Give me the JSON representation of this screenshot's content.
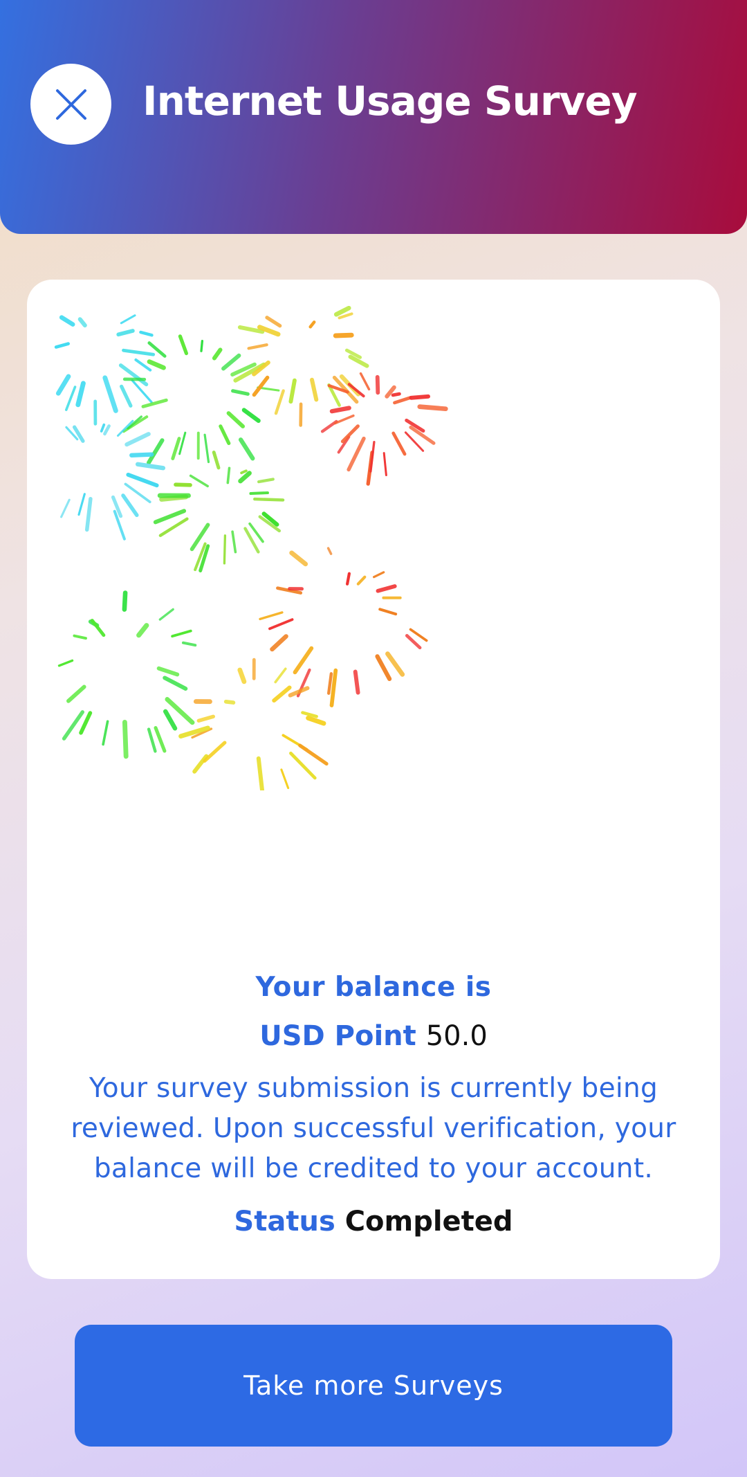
{
  "header": {
    "title": "Internet Usage Survey",
    "close_icon": "close-icon"
  },
  "card": {
    "animation": "fireworks",
    "balance_label": "Your balance is",
    "currency_label": "USD Point",
    "balance_value": "50.0",
    "message": "Your survey submission is currently being reviewed. Upon successful verification, your balance will be credited to your account.",
    "status_label": "Status",
    "status_value": "Completed"
  },
  "cta": {
    "label": "Take more Surveys"
  },
  "colors": {
    "primary": "#2d6ae4",
    "text_blue": "#2e68de",
    "header_start": "#3470e0",
    "header_end": "#a80c3c"
  }
}
